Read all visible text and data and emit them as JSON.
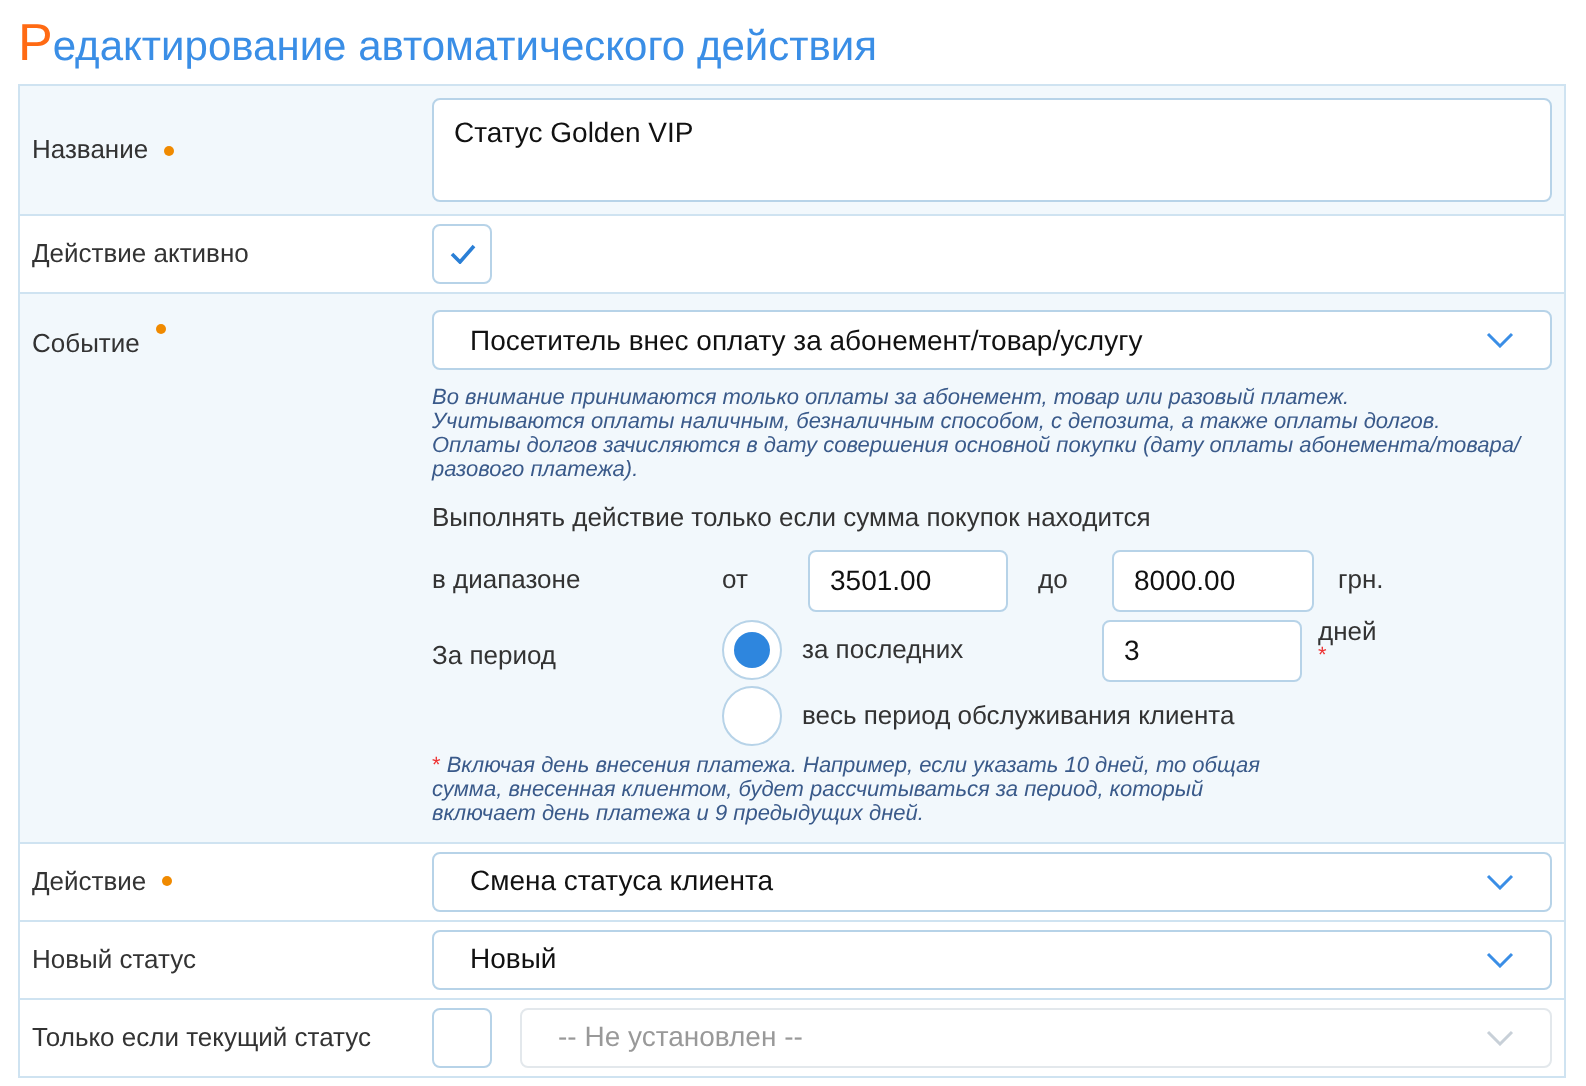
{
  "title": "Редактирование автоматического действия",
  "rows": [
    {
      "kind": "textarea",
      "label": "Название",
      "required": true,
      "shaded": true,
      "value": "Статус Golden VIP"
    },
    {
      "kind": "checkbox",
      "label": "Действие активно",
      "required": false,
      "shaded": false,
      "checked": true
    },
    {
      "kind": "event",
      "label": "Событие",
      "required": true,
      "shaded": true,
      "value": "Посетитель внес оплату за абонемент/товар/услугу",
      "note": [
        "Во внимание принимаются только оплаты за абонемент, товар или разовый платеж.",
        "Учитываются оплаты наличным, безналичным способом, с депозита, а также оплаты долгов.",
        "Оплаты долгов зачисляются в дату совершения основной покупки (дату оплаты абонемента/товара/",
        "разового платежа)."
      ],
      "condition": "Выполнять действие только если сумма покупок находится",
      "range": {
        "label": "в диапазоне",
        "from_label": "от",
        "from": "3501.00",
        "to_label": "до",
        "to": "8000.00",
        "unit": "грн."
      },
      "period": {
        "label": "За период",
        "options": [
          {
            "label": "за последних",
            "selected": true,
            "value": "3",
            "unit": "дней",
            "mark": "*"
          },
          {
            "label": "весь период обслуживания клиента",
            "selected": false
          }
        ]
      },
      "footnote": {
        "mark": "*",
        "lines": [
          "Включая день внесения платежа. Например, если указать 10 дней, то общая",
          "сумма, внесенная клиентом, будет рассчитываться за период, который",
          "включает день платежа и 9 предыдущих дней."
        ]
      }
    },
    {
      "kind": "select",
      "label": "Действие",
      "required": true,
      "shaded": false,
      "value": "Смена статуса клиента"
    },
    {
      "kind": "select",
      "label": "Новый статус",
      "required": false,
      "shaded": false,
      "value": "Новый"
    },
    {
      "kind": "checkbox_select",
      "label": "Только если текущий статус",
      "required": false,
      "shaded": false,
      "checked": false,
      "value": "-- Не установлен --",
      "disabled": true
    }
  ]
}
